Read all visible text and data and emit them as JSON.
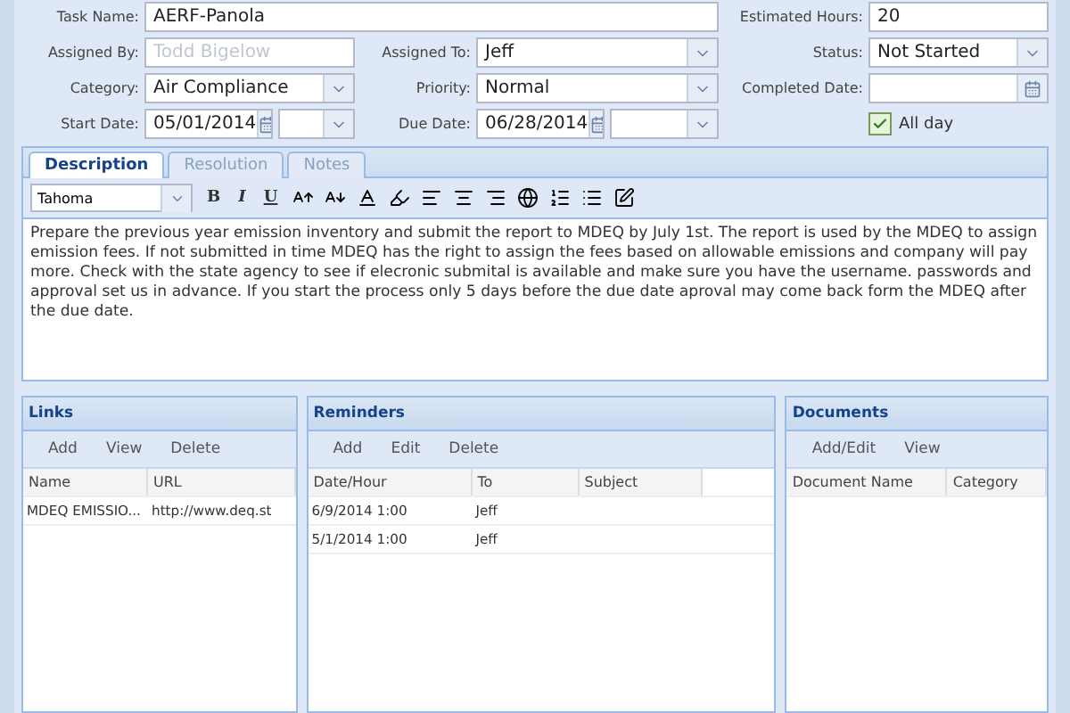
{
  "form": {
    "rows": [
      [
        {
          "kind": "text",
          "label": "Task Name:",
          "value": "AERF-Panola"
        },
        {
          "kind": "text",
          "label": "Estimated Hours:",
          "value": "20"
        }
      ],
      [
        {
          "kind": "text",
          "label": "Assigned By:",
          "value": "Todd Bigelow",
          "disabled": true
        },
        {
          "kind": "select",
          "label": "Assigned To:",
          "value": "Jeff"
        },
        {
          "kind": "select",
          "label": "Status:",
          "value": "Not Started"
        }
      ],
      [
        {
          "kind": "select",
          "label": "Category:",
          "value": "Air Compliance"
        },
        {
          "kind": "select",
          "label": "Priority:",
          "value": "Normal"
        },
        {
          "kind": "date",
          "label": "Completed Date:"
        }
      ],
      [
        {
          "kind": "datetime",
          "label": "Start Date:",
          "value": "05/01/2014"
        },
        {
          "kind": "datetime",
          "label": "Due Date:",
          "value": "06/28/2014"
        },
        {
          "kind": "checkbox",
          "label": "All day",
          "checked": true
        }
      ]
    ]
  },
  "tabs": [
    {
      "label": "Description",
      "selected": true
    },
    {
      "label": "Resolution",
      "selected": false
    },
    {
      "label": "Notes",
      "selected": false
    }
  ],
  "editor": {
    "font": "Tahoma",
    "format_buttons": [
      "B",
      "I",
      "U"
    ],
    "text": "Prepare the previous year emission inventory and submit the report to MDEQ by July 1st. The report is used by the MDEQ to assign emission fees. If not submitted in time MDEQ has the right to assign the fees based on allowable emissions and company will pay more. Check with the state agency to see if elecronic submital is available and make sure you have the username. passwords and approval set us in advance. If you start the process only 5 days before the due date aproval may come back form the MDEQ after the due date."
  },
  "panels": [
    {
      "title": "Links",
      "actions": [
        "Add",
        "View",
        "Delete"
      ],
      "columns": [
        "Name",
        "URL"
      ],
      "rows": [
        [
          "MDEQ EMISSIO...",
          "http://www.deq.st"
        ]
      ]
    },
    {
      "title": "Reminders",
      "actions": [
        "Add",
        "Edit",
        "Delete"
      ],
      "columns": [
        "Date/Hour",
        "To",
        "Subject"
      ],
      "rows": [
        [
          "6/9/2014 1:00",
          "Jeff",
          ""
        ],
        [
          "5/1/2014 1:00",
          "Jeff",
          ""
        ]
      ]
    },
    {
      "title": "Documents",
      "actions": [
        "Add/Edit",
        "View"
      ],
      "columns": [
        "Document Name",
        "Category"
      ]
    }
  ]
}
